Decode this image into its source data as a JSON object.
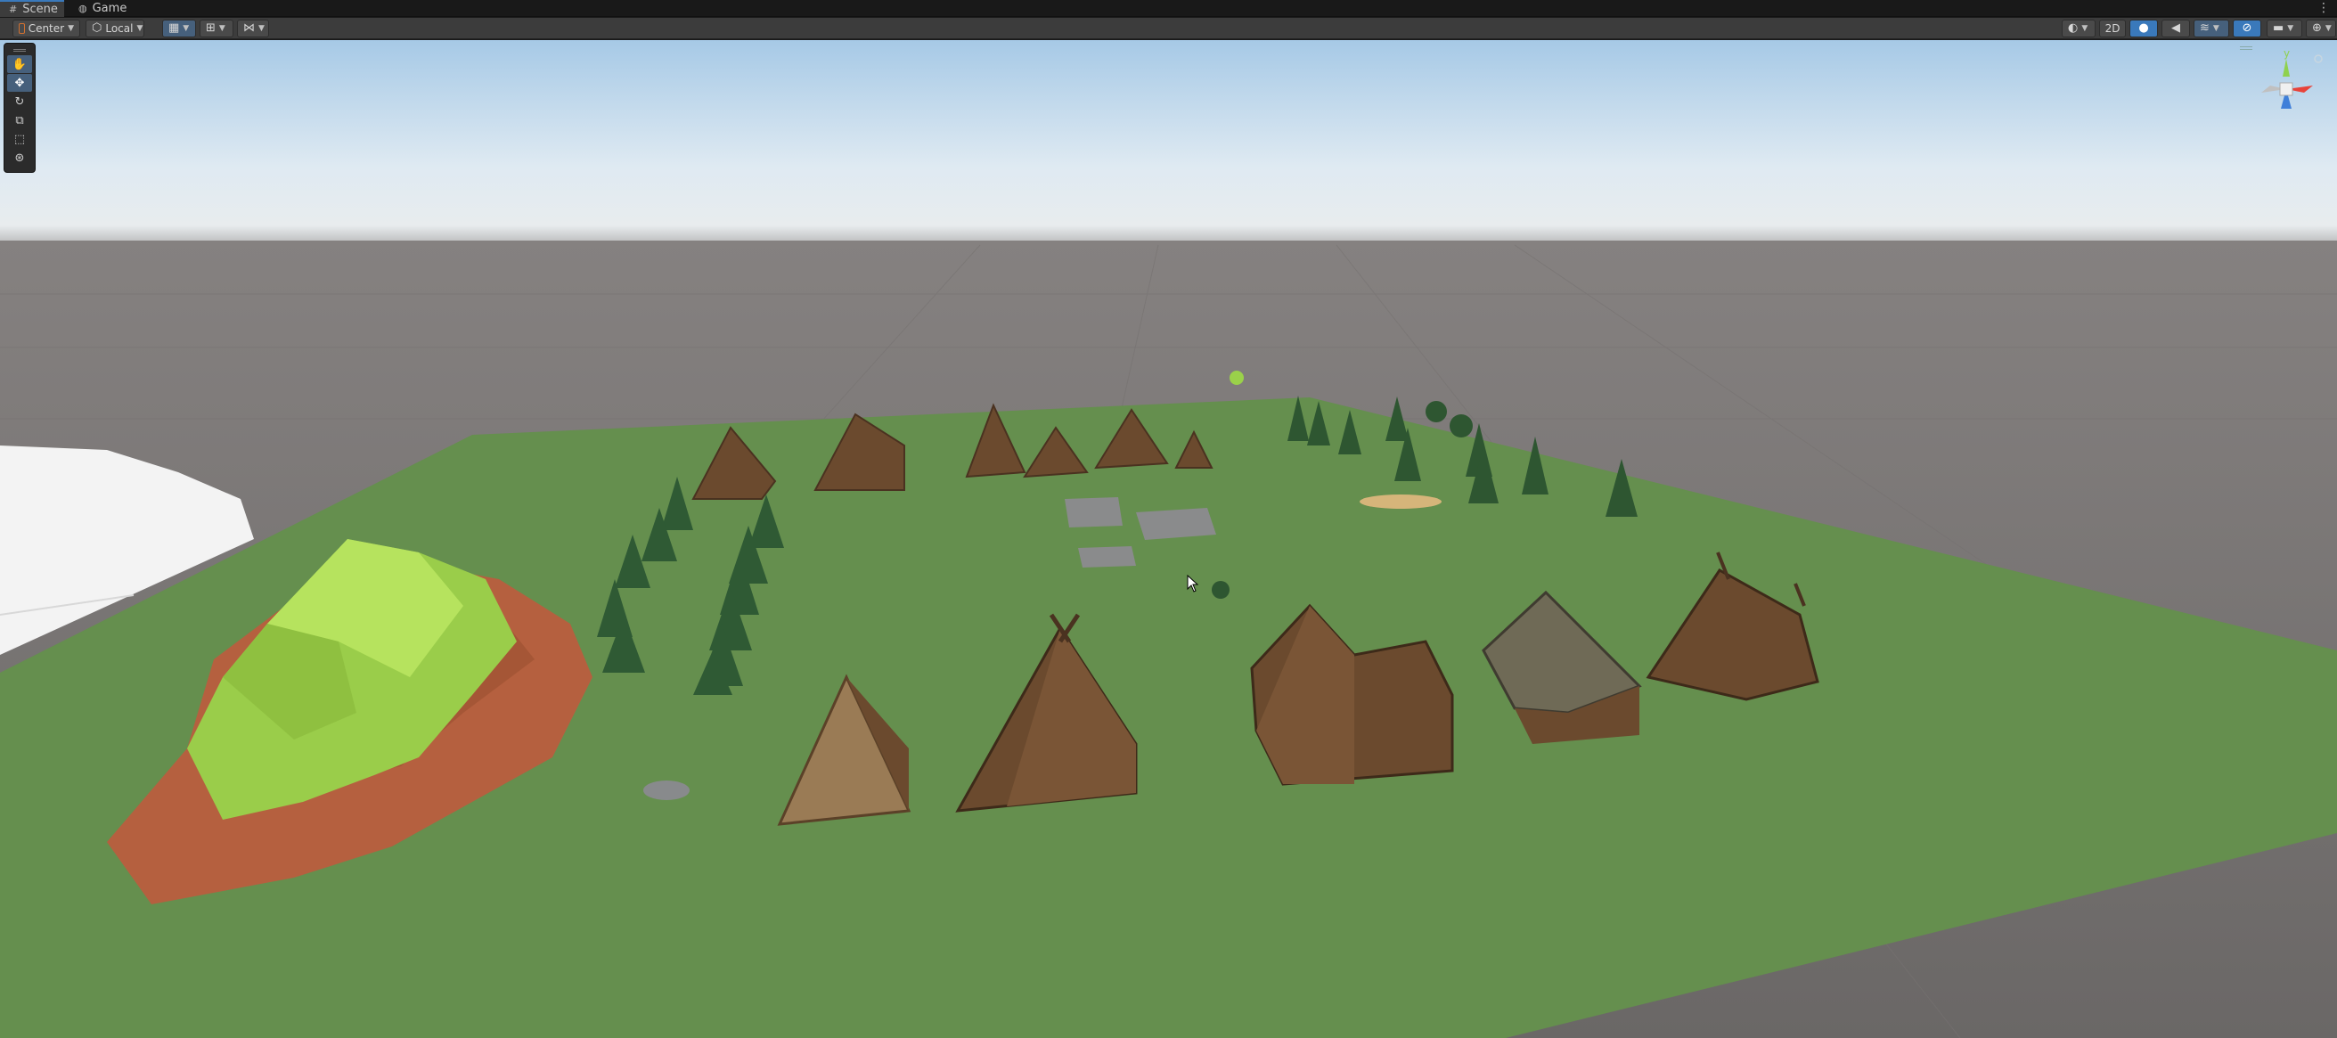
{
  "tabs": [
    {
      "label": "Scene",
      "icon": "scene-grid-icon",
      "active": true
    },
    {
      "label": "Game",
      "icon": "gamepad-icon",
      "active": false
    }
  ],
  "toolbar": {
    "pivot_label": "Center",
    "space_label": "Local",
    "mode_2d_label": "2D"
  },
  "scene": {
    "sky_color": "#c4dcee",
    "ground_color": "#6a6766",
    "terrain_color": "#658f4e",
    "snow_color": "#f2f2f2",
    "mountain_grass": "#9acd4a",
    "mountain_rock": "#b5603f"
  },
  "gizmo": {
    "y_axis_label": "y",
    "x_color": "#e8433a",
    "y_color": "#8fd14f",
    "z_color": "#3f7fd9"
  },
  "colors": {
    "accent": "#3a79bb",
    "panel": "#3c3c3c",
    "wood": "#6b4a2e",
    "pine": "#2f5a34"
  }
}
